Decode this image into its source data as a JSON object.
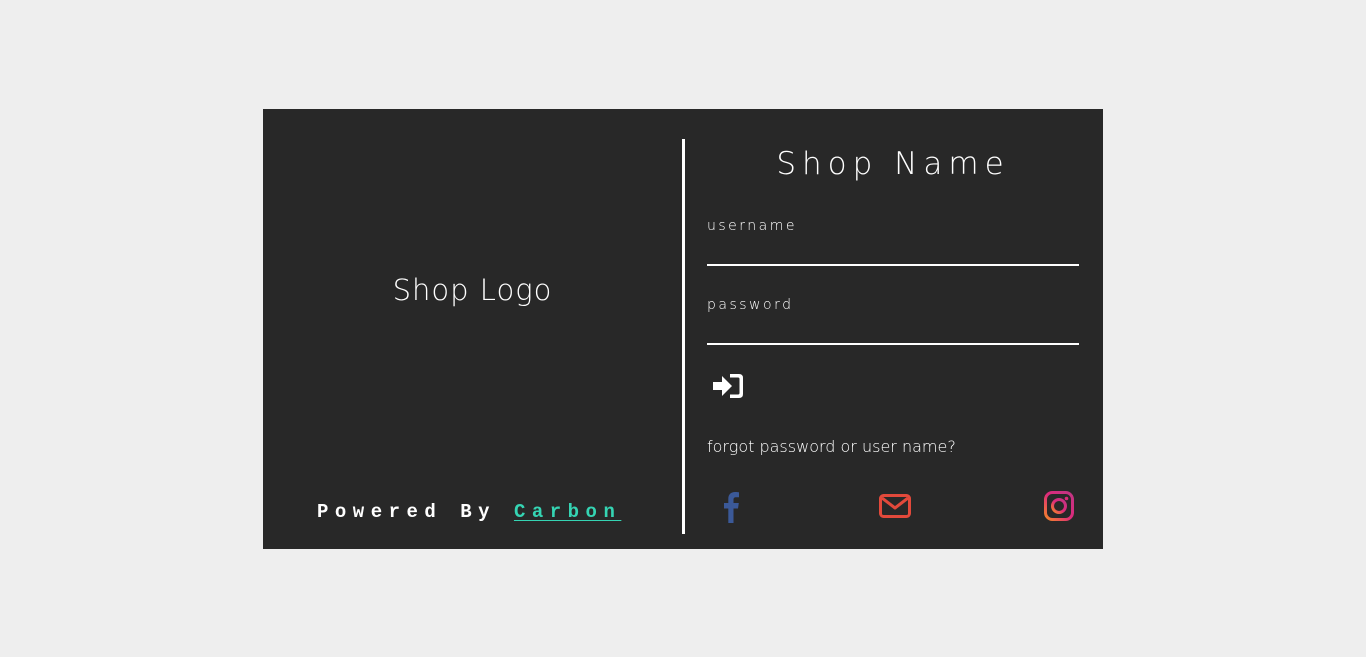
{
  "left_panel": {
    "logo_text": "Shop Logo",
    "powered_by_label": "Powered By",
    "powered_by_link": "Carbon"
  },
  "right_panel": {
    "shop_name": "Shop Name",
    "username_label": "username",
    "username_value": "",
    "password_label": "password",
    "password_value": "",
    "login_icon": "sign-in-icon",
    "forgot_link": "forgot password or user name?",
    "social": [
      {
        "icon": "facebook-icon",
        "color": "#3b5998"
      },
      {
        "icon": "mail-icon",
        "color": "#e2493b"
      },
      {
        "icon": "instagram-icon",
        "color": "#e1306c"
      }
    ]
  },
  "colors": {
    "page_background": "#eeeeee",
    "card_background": "#282828",
    "text": "#ffffff",
    "accent_link": "#35d4b3"
  }
}
